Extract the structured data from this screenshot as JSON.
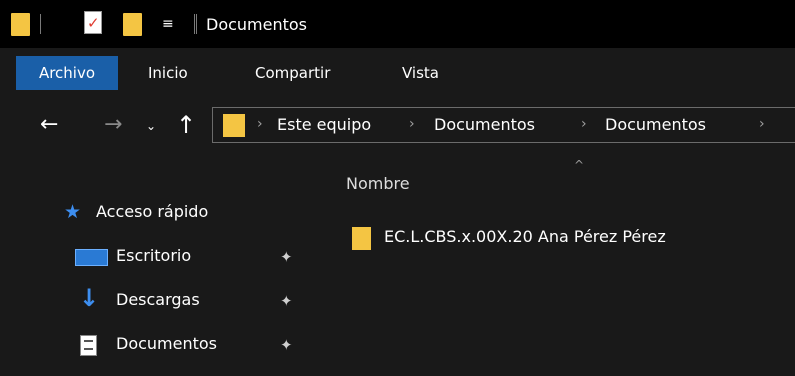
{
  "titlebar": {
    "title": "Documentos",
    "quick_access_menu": "≡"
  },
  "ribbon": {
    "tabs": [
      "Archivo",
      "Inicio",
      "Compartir",
      "Vista"
    ],
    "active_color": "#1a5fa8"
  },
  "navigation": {
    "back": "←",
    "forward": "→",
    "recent": "⌄",
    "up": "↑",
    "breadcrumb": [
      "Este equipo",
      "Documentos",
      "Documentos"
    ],
    "separator": "›"
  },
  "sidebar": {
    "items": [
      {
        "label": "Acceso rápido",
        "icon": "star-icon"
      },
      {
        "label": "Escritorio",
        "icon": "desktop-icon",
        "pinned": true
      },
      {
        "label": "Descargas",
        "icon": "download-arrow-icon",
        "pinned": true
      },
      {
        "label": "Documentos",
        "icon": "documents-icon",
        "pinned": true
      }
    ],
    "pin_glyph": "📌"
  },
  "content": {
    "column_header": "Nombre",
    "sort_indicator": "^",
    "files": [
      {
        "name": "EC.L.CBS.x.00X.20 Ana Pérez Pérez",
        "icon": "folder-icon"
      }
    ]
  },
  "colors": {
    "background": "#191919",
    "titlebar": "#000000",
    "folder": "#f4c543",
    "accent": "#3d8ef0"
  }
}
